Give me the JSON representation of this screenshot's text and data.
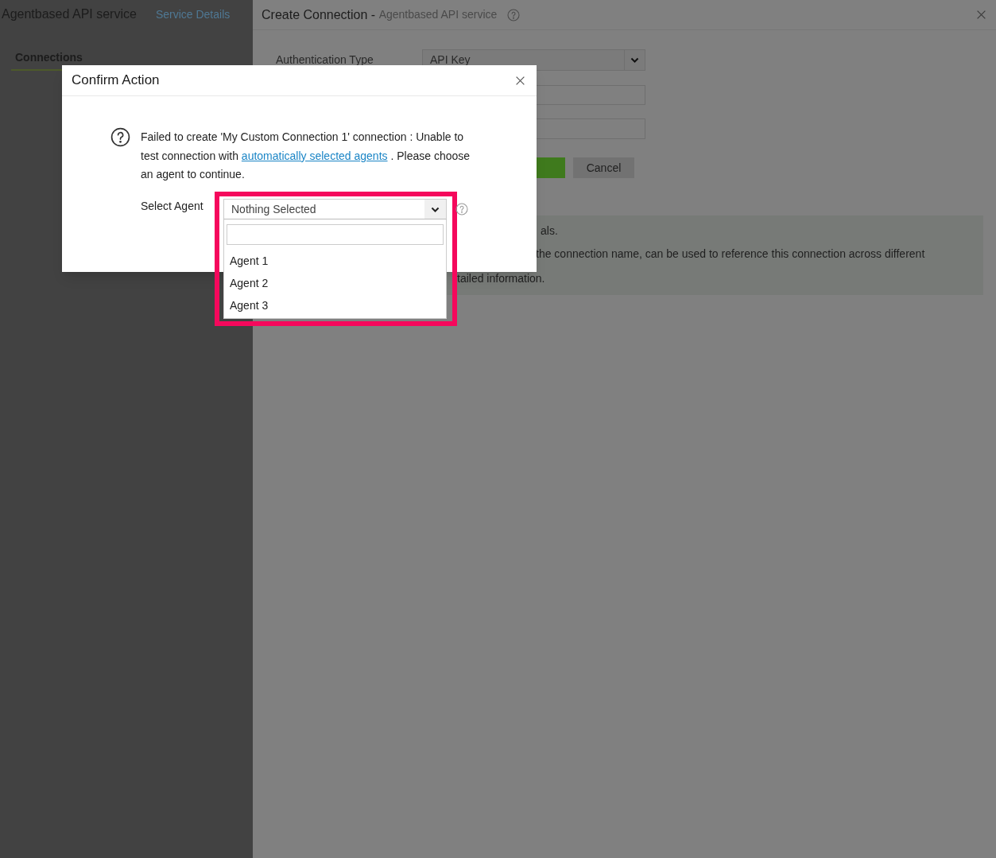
{
  "left_panel": {
    "title": "Agentbased API service",
    "link": "Service Details",
    "tabs": [
      {
        "label": "Connections",
        "selected": true
      }
    ]
  },
  "right_panel": {
    "title": "Create Connection - ",
    "subtitle": "Agentbased API service",
    "auth_label": "Authentication Type",
    "auth_value": "API Key",
    "cancel": "Cancel",
    "info_lines": [
      "als.",
      "the connection name, can be used to reference this connection across different",
      "tailed information."
    ]
  },
  "dialog": {
    "title": "Confirm Action",
    "message_before": "Failed to create 'My Custom Connection 1' connection : Unable to test connection with ",
    "message_link": "automatically selected agents",
    "message_after": " . Please choose an agent to continue.",
    "select_label": "Select Agent",
    "select": {
      "value": "Nothing Selected",
      "expanded": true,
      "options": [
        {
          "label": "Agent 1",
          "selected": false
        },
        {
          "label": "Agent 2",
          "selected": false
        },
        {
          "label": "Agent 3",
          "selected": false
        }
      ]
    }
  }
}
